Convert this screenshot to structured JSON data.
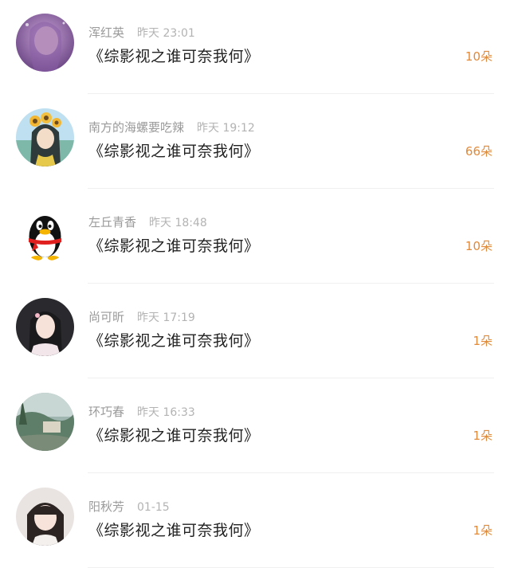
{
  "gifts": [
    {
      "name": "浑红英",
      "time": "昨天 23:01",
      "title": "《综影视之谁可奈我何》",
      "count": "10朵",
      "avatar": "avatar-purple-portrait"
    },
    {
      "name": "南方的海螺要吃辣",
      "time": "昨天 19:12",
      "title": "《综影视之谁可奈我何》",
      "count": "66朵",
      "avatar": "avatar-sunflower-girl"
    },
    {
      "name": "左丘青香",
      "time": "昨天 18:48",
      "title": "《综影视之谁可奈我何》",
      "count": "10朵",
      "avatar": "avatar-qq-penguin"
    },
    {
      "name": "尚可昕",
      "time": "昨天 17:19",
      "title": "《综影视之谁可奈我何》",
      "count": "1朵",
      "avatar": "avatar-girl-portrait"
    },
    {
      "name": "环巧春",
      "time": "昨天 16:33",
      "title": "《综影视之谁可奈我何》",
      "count": "1朵",
      "avatar": "avatar-landscape"
    },
    {
      "name": "阳秋芳",
      "time": "01-15",
      "title": "《综影视之谁可奈我何》",
      "count": "1朵",
      "avatar": "avatar-child-portrait"
    }
  ],
  "colors": {
    "gift_count": "#e08a3c",
    "name": "#9a9a9a",
    "title": "#222222"
  }
}
